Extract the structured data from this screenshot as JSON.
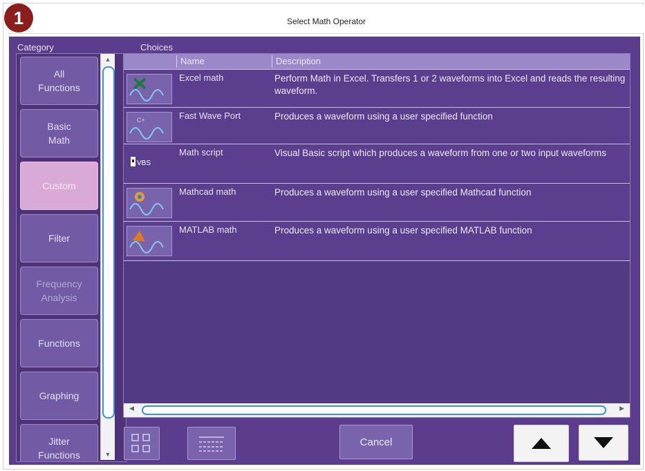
{
  "badge": "1",
  "window": {
    "title": "Select Math Operator"
  },
  "headers": {
    "category": "Category",
    "choices": "Choices"
  },
  "categories": [
    {
      "label": "All\nFunctions",
      "state": "normal"
    },
    {
      "label": "Basic\nMath",
      "state": "normal"
    },
    {
      "label": "Custom",
      "state": "selected"
    },
    {
      "label": "Filter",
      "state": "normal"
    },
    {
      "label": "Frequency\nAnalysis",
      "state": "dim"
    },
    {
      "label": "Functions",
      "state": "normal"
    },
    {
      "label": "Graphing",
      "state": "normal"
    },
    {
      "label": "Jitter\nFunctions",
      "state": "normal"
    }
  ],
  "table": {
    "columns": [
      "",
      "Name",
      "Description"
    ],
    "rows": [
      {
        "icon": "excel-waveform-icon",
        "name": "Excel math",
        "description": "Perform Math in Excel. Transfers 1 or 2 waveforms into Excel and reads the resulting waveform."
      },
      {
        "icon": "custom-dll-waveform-icon",
        "name": "Fast Wave Port",
        "description": "Produces a waveform using a user specified function"
      },
      {
        "icon": "vbs-script-icon",
        "name": "Math script",
        "description": "Visual Basic script which produces a waveform from one or two input waveforms"
      },
      {
        "icon": "mathcad-waveform-icon",
        "name": "Mathcad math",
        "description": "Produces a waveform using a user specified Mathcad function"
      },
      {
        "icon": "matlab-waveform-icon",
        "name": "MATLAB math",
        "description": "Produces a waveform using a user specified MATLAB function"
      }
    ]
  },
  "buttons": {
    "icon_view": "icon-view-button",
    "list_view": "list-view-button",
    "cancel": "Cancel",
    "up": "up-arrow-icon",
    "down": "down-arrow-icon"
  },
  "colors": {
    "dialog_bg": "#5b3c8d",
    "selected_category": "#d9a9d7",
    "badge": "#8b1d1d",
    "scroll_accent": "#3b8fe0"
  }
}
